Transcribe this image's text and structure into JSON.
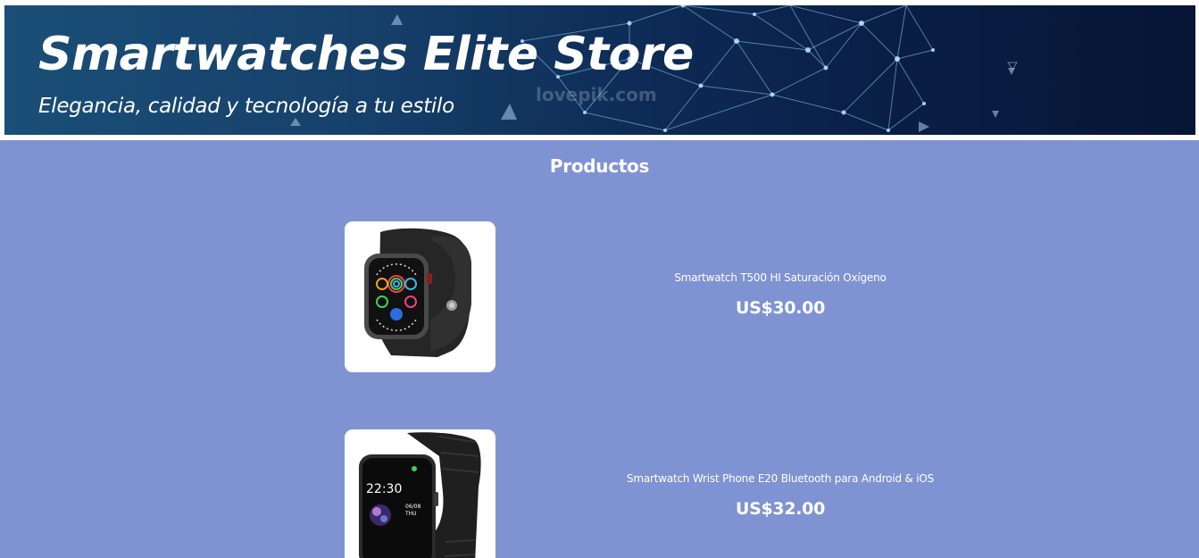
{
  "header": {
    "title": "Smartwatches Elite Store",
    "subtitle": "Elegancia, calidad y tecnología a tu estilo",
    "watermark": "lovepik.com"
  },
  "section": {
    "title": "Productos"
  },
  "products": [
    {
      "name": "Smartwatch T500 HI Saturación Oxígeno",
      "price": "US$30.00",
      "image_icon": "smartwatch-round-band-icon"
    },
    {
      "name": "Smartwatch Wrist Phone E20 Bluetooth para Android & iOS",
      "price": "US$32.00",
      "image_icon": "smartwatch-square-band-icon",
      "screen_time": "22:30",
      "screen_date_1": "06/08",
      "screen_date_2": "THU"
    }
  ],
  "colors": {
    "section_background": "#7f93d3",
    "banner_dark": "#0a1e45",
    "banner_light": "#1a4f77",
    "text": "#ffffff"
  }
}
